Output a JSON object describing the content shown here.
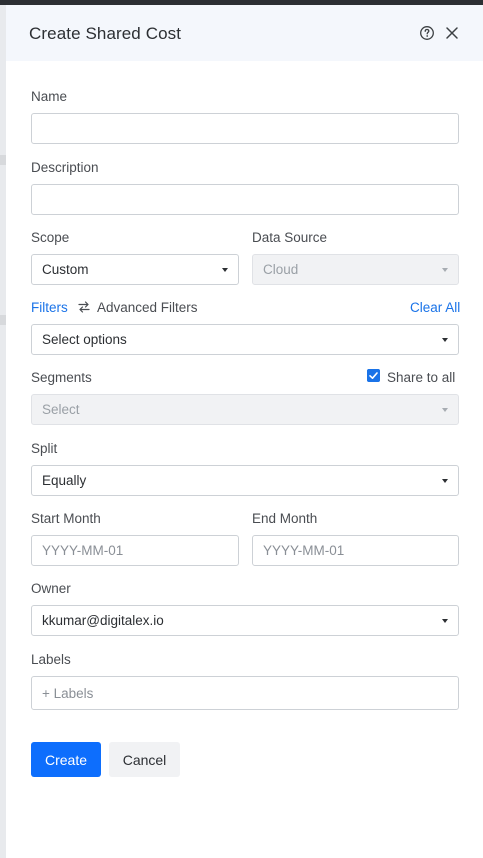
{
  "drawer": {
    "title": "Create Shared Cost",
    "help_icon": "help-circle-icon",
    "close_icon": "close-icon"
  },
  "form": {
    "name": {
      "label": "Name",
      "value": ""
    },
    "description": {
      "label": "Description",
      "value": ""
    },
    "scope": {
      "label": "Scope",
      "selected": "Custom"
    },
    "data_source": {
      "label": "Data Source",
      "selected": "Cloud",
      "disabled": true
    },
    "filters": {
      "tab_label": "Filters",
      "advanced_label": "Advanced Filters",
      "clear_label": "Clear All",
      "placeholder": "Select options"
    },
    "segments": {
      "label": "Segments",
      "share_label": "Share to all",
      "share_checked": true,
      "placeholder": "Select",
      "disabled": true
    },
    "split": {
      "label": "Split",
      "selected": "Equally"
    },
    "start_month": {
      "label": "Start Month",
      "placeholder": "YYYY-MM-01"
    },
    "end_month": {
      "label": "End Month",
      "placeholder": "YYYY-MM-01"
    },
    "owner": {
      "label": "Owner",
      "selected": "kkumar@digitalex.io"
    },
    "labels": {
      "label": "Labels",
      "placeholder": "+ Labels"
    }
  },
  "actions": {
    "create_label": "Create",
    "cancel_label": "Cancel"
  },
  "colors": {
    "accent": "#1a73e8",
    "primary_button": "#0d6efd",
    "header_bg": "#f4f7fc"
  }
}
